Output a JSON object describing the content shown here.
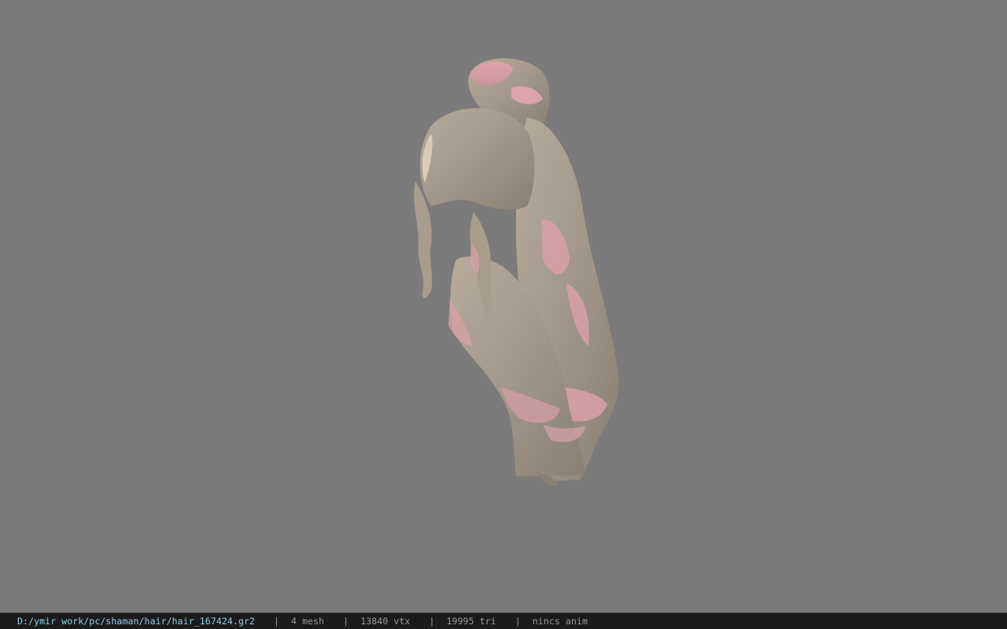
{
  "viewport": {
    "background_color": "#7b7b7b",
    "model": {
      "hair_color": "#a79a89",
      "tint_color": "#d9a0a6"
    }
  },
  "status_bar": {
    "file_path": "D:/ymir work/pc/shaman/hair/hair_167424.gr2",
    "separator": "|",
    "mesh_count": "4 mesh",
    "vertex_count": "13840 vtx",
    "triangle_count": "19995 tri",
    "anim_status": "nincs anim",
    "path_color": "#8fd0ea",
    "text_color": "#9a9a9a"
  }
}
